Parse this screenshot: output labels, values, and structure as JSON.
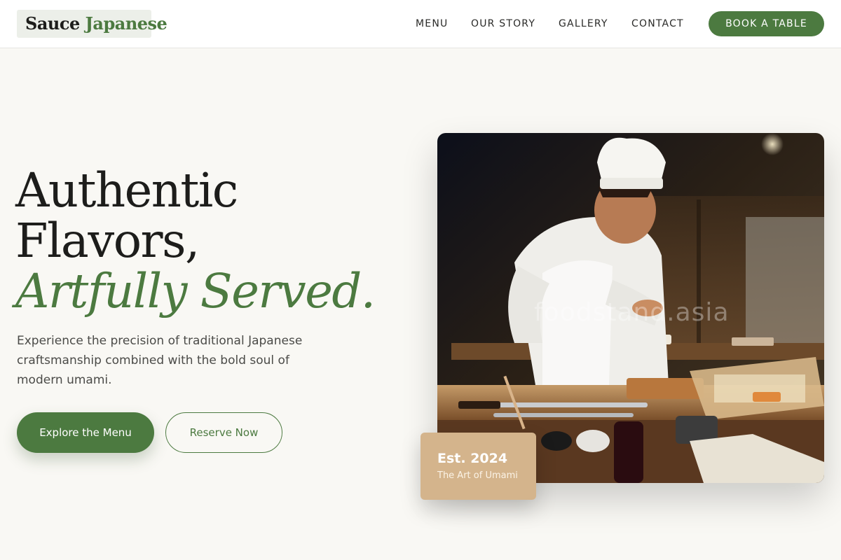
{
  "brand": {
    "name_first": "Sauce",
    "name_second": "Japanese",
    "accent_color": "#4c7a40"
  },
  "nav": {
    "items": [
      {
        "label": "MENU"
      },
      {
        "label": "OUR STORY"
      },
      {
        "label": "GALLERY"
      },
      {
        "label": "CONTACT"
      }
    ],
    "cta_label": "BOOK A TABLE"
  },
  "hero": {
    "headline_line1": "Authentic",
    "headline_line2": "Flavors,",
    "headline_accent": "Artfully Served.",
    "lead": "Experience the precision of traditional Japanese craftsmanship combined with the bold soul of modern umami.",
    "primary_button": "Explore the Menu",
    "secondary_button": "Reserve Now",
    "image_watermark": "foodstand.asia",
    "badge_title": "Est. 2024",
    "badge_subtitle": "The Art of Umami"
  }
}
